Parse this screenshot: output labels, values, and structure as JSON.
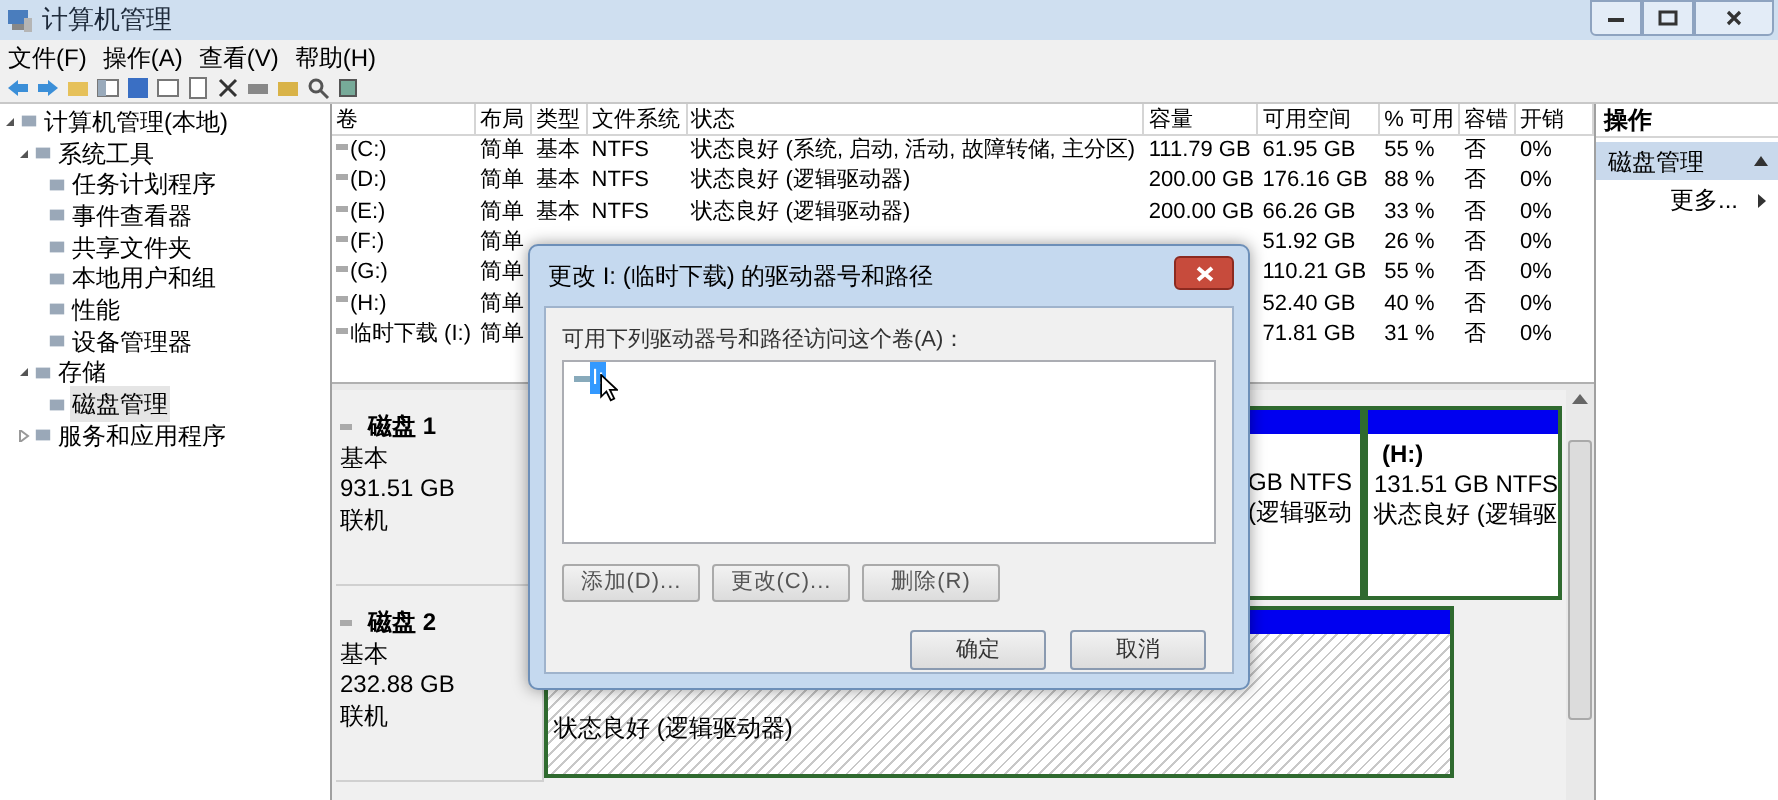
{
  "window": {
    "title": "计算机管理"
  },
  "menu": [
    "文件(F)",
    "操作(A)",
    "查看(V)",
    "帮助(H)"
  ],
  "tree": [
    {
      "label": "计算机管理(本地)",
      "selected": false,
      "expanded": true,
      "children": [
        {
          "label": "系统工具",
          "selected": false,
          "expanded": true,
          "children": [
            {
              "label": "任务计划程序",
              "selected": false
            },
            {
              "label": "事件查看器",
              "selected": false
            },
            {
              "label": "共享文件夹",
              "selected": false
            },
            {
              "label": "本地用户和组",
              "selected": false
            },
            {
              "label": "性能",
              "selected": false
            },
            {
              "label": "设备管理器",
              "selected": false
            }
          ]
        },
        {
          "label": "存储",
          "selected": false,
          "expanded": true,
          "children": [
            {
              "label": "磁盘管理",
              "selected": true
            }
          ]
        },
        {
          "label": "服务和应用程序",
          "selected": false,
          "expanded": false
        }
      ]
    }
  ],
  "table": {
    "columns": [
      "卷",
      "布局",
      "类型",
      "文件系统",
      "状态",
      "容量",
      "可用空间",
      "% 可用",
      "容错",
      "开销"
    ],
    "rows": [
      {
        "volume": "(C:)",
        "layout": "简单",
        "type": "基本",
        "fs": "NTFS",
        "status": "状态良好 (系统, 启动, 活动, 故障转储, 主分区)",
        "capacity": "111.79 GB",
        "free": "61.95 GB",
        "pct": "55 %",
        "fault": "否",
        "overhead": "0%"
      },
      {
        "volume": "(D:)",
        "layout": "简单",
        "type": "基本",
        "fs": "NTFS",
        "status": "状态良好 (逻辑驱动器)",
        "capacity": "200.00 GB",
        "free": "176.16 GB",
        "pct": "88 %",
        "fault": "否",
        "overhead": "0%"
      },
      {
        "volume": "(E:)",
        "layout": "简单",
        "type": "基本",
        "fs": "NTFS",
        "status": "状态良好 (逻辑驱动器)",
        "capacity": "200.00 GB",
        "free": "66.26 GB",
        "pct": "33 %",
        "fault": "否",
        "overhead": "0%"
      },
      {
        "volume": "(F:)",
        "layout": "简单",
        "free": "51.92 GB",
        "pct": "26 %",
        "fault": "否",
        "overhead": "0%"
      },
      {
        "volume": "(G:)",
        "layout": "简单",
        "free": "110.21 GB",
        "pct": "55 %",
        "fault": "否",
        "overhead": "0%"
      },
      {
        "volume": "(H:)",
        "layout": "简单",
        "free": "52.40 GB",
        "pct": "40 %",
        "fault": "否",
        "overhead": "0%"
      },
      {
        "volume": "临时下载 (I:)",
        "layout": "简单",
        "free": "71.81 GB",
        "pct": "31 %",
        "fault": "否",
        "overhead": "0%"
      }
    ]
  },
  "disks": [
    {
      "name": "磁盘 1",
      "type": "基本",
      "size": "931.51 GB",
      "state": "联机",
      "partitions": [
        {
          "kind": "plain",
          "size_fs": "GB NTFS",
          "status": "(逻辑驱动"
        },
        {
          "kind": "plain",
          "label": "(H:)",
          "size_fs": "131.51 GB NTFS",
          "status": "状态良好 (逻辑驱"
        }
      ]
    },
    {
      "name": "磁盘 2",
      "type": "基本",
      "size": "232.88 GB",
      "state": "联机",
      "partitions": [
        {
          "kind": "hatched",
          "status": "状态良好 (逻辑驱动器)"
        }
      ]
    }
  ],
  "actions": {
    "title": "操作",
    "items": [
      {
        "label": "磁盘管理",
        "kind": "section"
      },
      {
        "label": "更多...",
        "kind": "submenu"
      }
    ]
  },
  "dialog": {
    "title": "更改 I: (临时下载) 的驱动器号和路径",
    "prompt": "可用下列驱动器号和路径访问这个卷(A)：",
    "items": [
      {
        "label": "I:",
        "selected": true
      }
    ],
    "buttons": [
      "添加(D)...",
      "更改(C)...",
      "删除(R)"
    ],
    "footer_buttons": [
      "确定",
      "取消"
    ]
  }
}
